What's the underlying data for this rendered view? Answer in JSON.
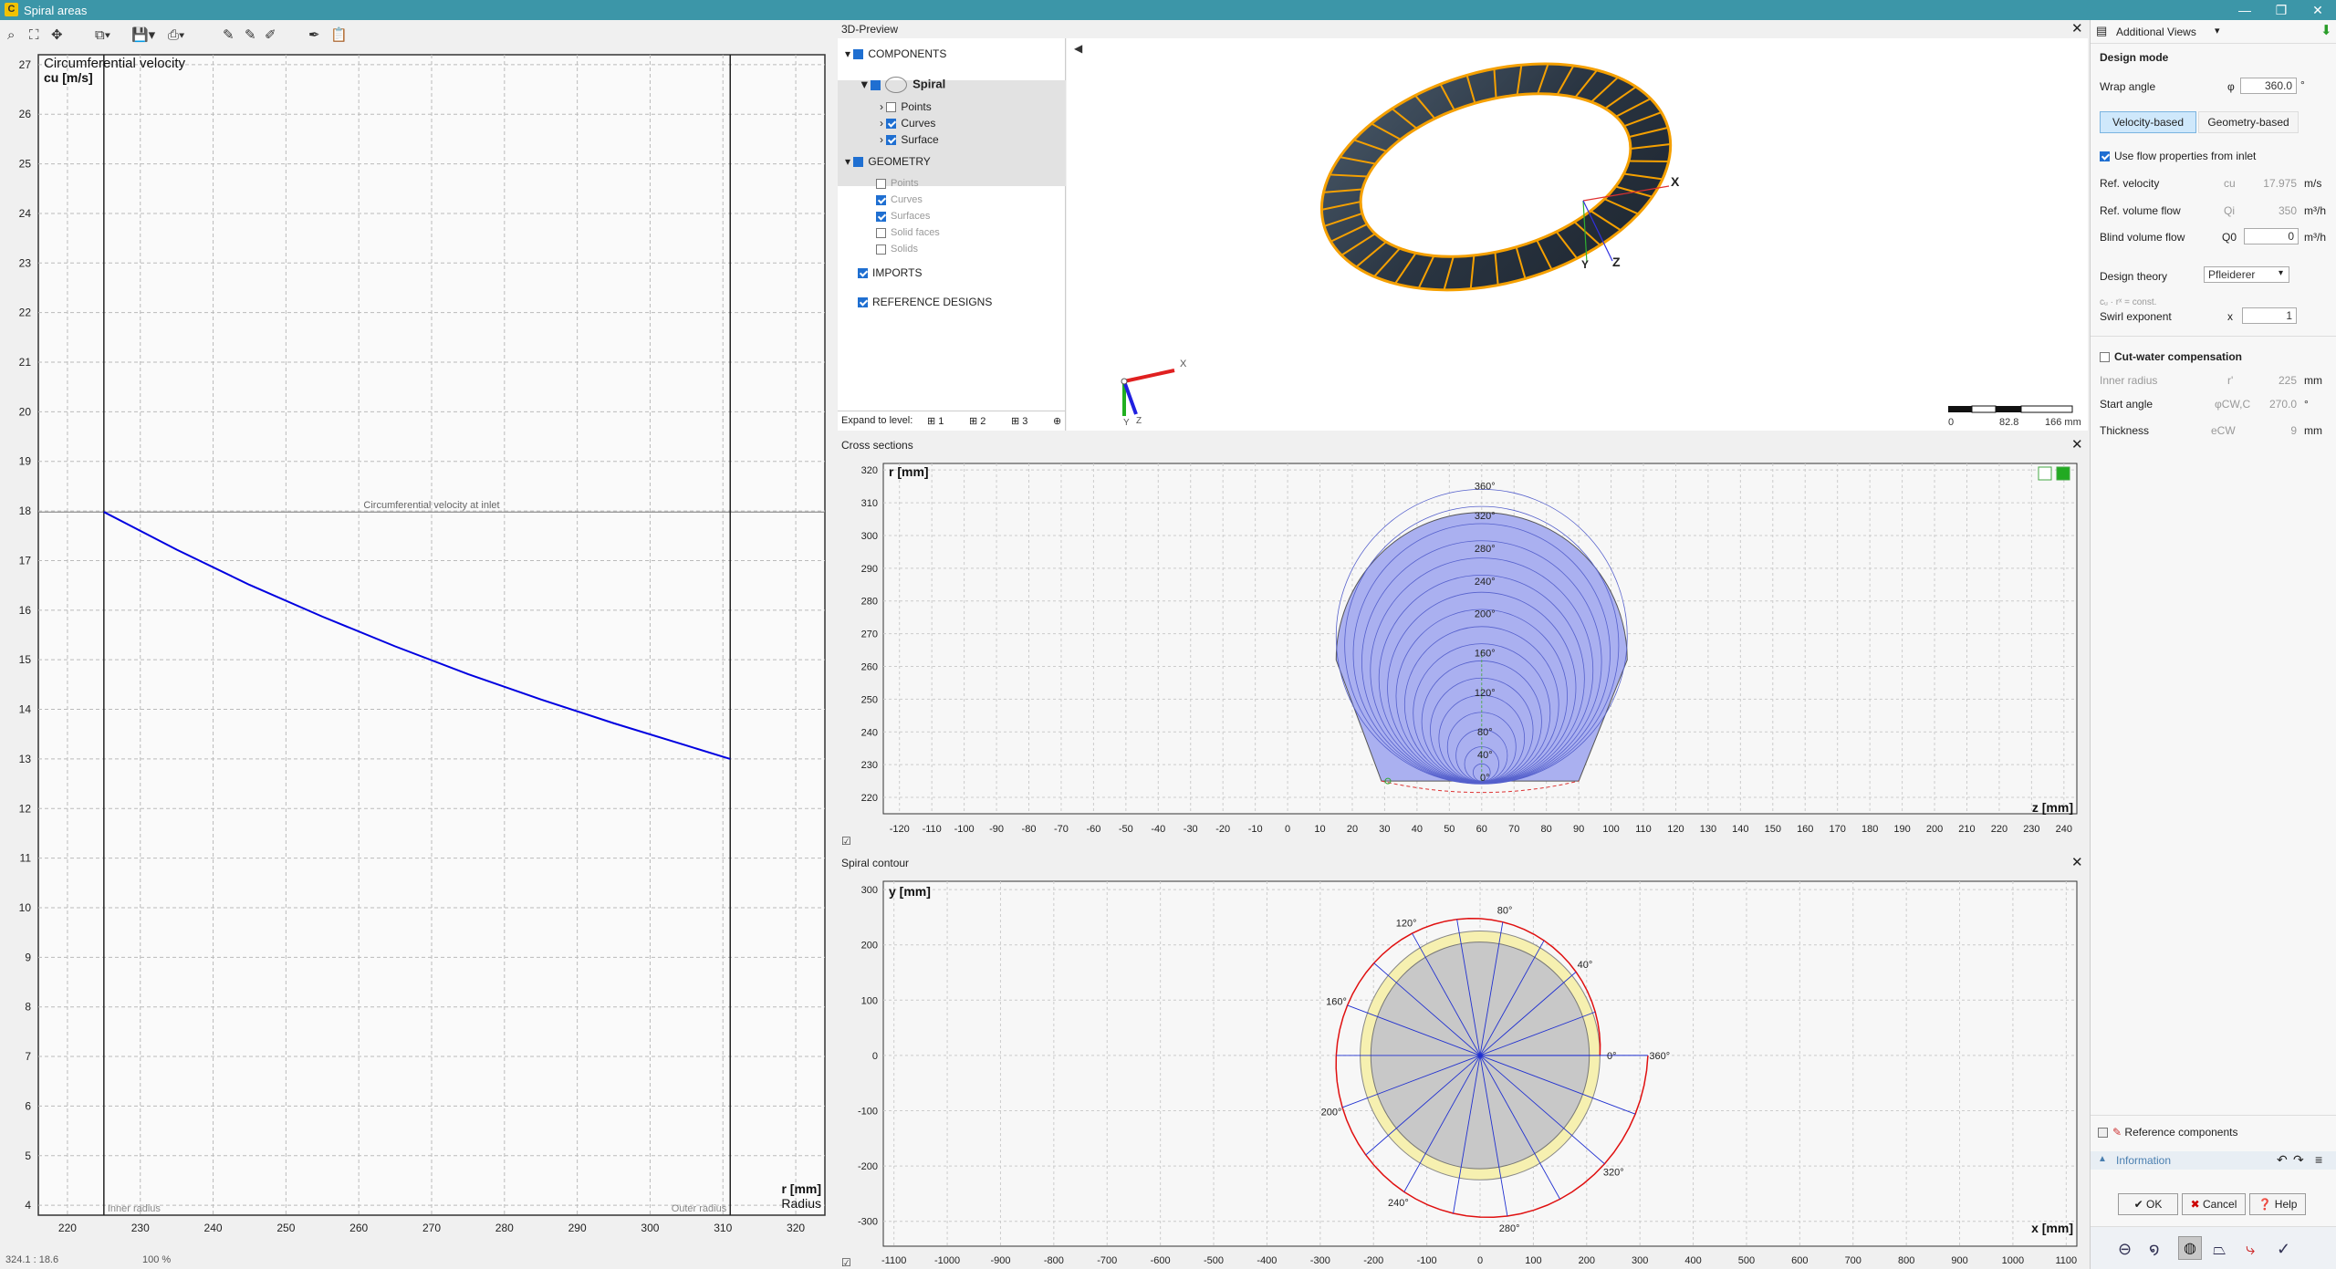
{
  "window": {
    "title": "Spiral areas",
    "app_icon": "C",
    "buttons": [
      "—",
      "❐",
      "✕"
    ]
  },
  "left_chart": {
    "title": "Circumferential velocity",
    "ylabel": "cu [m/s]",
    "xlabel": "r [mm]",
    "xlabel2": "Radius",
    "inlet_label": "Circumferential velocity at inlet",
    "inner_label": "Inner radius",
    "outer_label": "Outer radius",
    "status": "324.1 : 18.6",
    "zoom": "100 %"
  },
  "preview": {
    "title": "3D-Preview",
    "tree": {
      "components": "COMPONENTS",
      "spiral": "Spiral",
      "points": "Points",
      "curves": "Curves",
      "surface": "Surface",
      "geometry": "GEOMETRY",
      "g_points": "Points",
      "g_curves": "Curves",
      "g_surfaces": "Surfaces",
      "g_solid_faces": "Solid faces",
      "g_solids": "Solids",
      "imports": "IMPORTS",
      "reference": "REFERENCE DESIGNS"
    },
    "expand_label": "Expand to level:",
    "levels": [
      "1",
      "2",
      "3"
    ],
    "axis_x": "X",
    "axis_y": "Y",
    "axis_z": "Z",
    "scale": [
      "0",
      "82.8",
      "166 mm"
    ]
  },
  "cross_sections": {
    "title": "Cross sections",
    "ylabel": "r [mm]",
    "xlabel": "z [mm]"
  },
  "spiral_contour": {
    "title": "Spiral contour",
    "ylabel": "y [mm]",
    "xlabel": "x [mm]"
  },
  "right_panel": {
    "view_select": "Additional Views",
    "design_mode": "Design mode",
    "wrap_angle_label": "Wrap angle",
    "wrap_angle_sym": "φ",
    "wrap_angle_value": "360.0",
    "wrap_angle_unit": "°",
    "tab_velocity": "Velocity-based",
    "tab_geometry": "Geometry-based",
    "use_flow": "Use flow properties from inlet",
    "ref_velocity_label": "Ref. velocity",
    "ref_velocity_sym": "cu",
    "ref_velocity_value": "17.975",
    "ref_velocity_unit": "m/s",
    "ref_flow_label": "Ref. volume flow",
    "ref_flow_sym": "Qi",
    "ref_flow_value": "350",
    "ref_flow_unit": "m³/h",
    "blind_flow_label": "Blind volume flow",
    "blind_flow_sym": "Q0",
    "blind_flow_value": "0",
    "blind_flow_unit": "m³/h",
    "design_theory_label": "Design theory",
    "design_theory_value": "Pfleiderer",
    "formula": "cᵤ · rˣ = const.",
    "swirl_label": "Swirl exponent",
    "swirl_sym": "x",
    "swirl_value": "1",
    "cutwater_label": "Cut-water compensation",
    "inner_radius_label": "Inner radius",
    "inner_radius_sym": "r'",
    "inner_radius_value": "225",
    "inner_radius_unit": "mm",
    "start_angle_label": "Start angle",
    "start_angle_sym": "φCW,C",
    "start_angle_value": "270.0",
    "start_angle_unit": "°",
    "thickness_label": "Thickness",
    "thickness_sym": "eCW",
    "thickness_value": "9",
    "thickness_unit": "mm",
    "reference_components": "Reference components",
    "information": "Information",
    "ok": "OK",
    "cancel": "Cancel",
    "help": "Help"
  },
  "colors": {
    "titlebar": "#3c96a8",
    "curve": "#0000e0",
    "checkbox": "#1f6fd1"
  },
  "chart_data": [
    {
      "type": "line",
      "title": "Circumferential velocity",
      "xlabel": "r [mm]",
      "ylabel": "cu [m/s]",
      "xlim": [
        216,
        324
      ],
      "ylim": [
        3.8,
        27.2
      ],
      "xticks": [
        220,
        230,
        240,
        250,
        260,
        270,
        280,
        290,
        300,
        310,
        320
      ],
      "yticks": [
        4,
        5,
        6,
        7,
        8,
        9,
        10,
        11,
        12,
        13,
        14,
        15,
        16,
        17,
        18,
        19,
        20,
        21,
        22,
        23,
        24,
        25,
        26,
        27
      ],
      "series": [
        {
          "name": "",
          "x": [
            225,
            235,
            245,
            255,
            265,
            275,
            285,
            295,
            305,
            311
          ],
          "y": [
            17.98,
            17.22,
            16.51,
            15.87,
            15.27,
            14.71,
            14.2,
            13.72,
            13.27,
            13.0
          ]
        }
      ],
      "inner_radius": 225,
      "outer_radius": 311,
      "inlet_velocity": 17.98,
      "grid": true
    },
    {
      "type": "scatter",
      "title": "Cross sections",
      "xlabel": "z [mm]",
      "ylabel": "r [mm]",
      "xlim": [
        -125,
        244
      ],
      "ylim": [
        215,
        322
      ],
      "xticks": [
        -120,
        -110,
        -100,
        -90,
        -80,
        -70,
        -60,
        -50,
        -40,
        -30,
        -20,
        -10,
        0,
        10,
        20,
        30,
        40,
        50,
        60,
        70,
        80,
        90,
        100,
        110,
        120,
        130,
        140,
        150,
        160,
        170,
        180,
        190,
        200,
        210,
        220,
        230,
        240
      ],
      "yticks": [
        220,
        230,
        240,
        250,
        260,
        270,
        280,
        290,
        300,
        310,
        320
      ],
      "angle_labels": [
        {
          "label": "360°",
          "z": 61,
          "r": 314
        },
        {
          "label": "320°",
          "z": 61,
          "r": 305
        },
        {
          "label": "280°",
          "z": 61,
          "r": 295
        },
        {
          "label": "240°",
          "z": 61,
          "r": 285
        },
        {
          "label": "200°",
          "z": 61,
          "r": 275
        },
        {
          "label": "160°",
          "z": 61,
          "r": 263
        },
        {
          "label": "120°",
          "z": 61,
          "r": 251
        },
        {
          "label": "80°",
          "z": 61,
          "r": 239
        },
        {
          "label": "40°",
          "z": 61,
          "r": 232
        },
        {
          "label": "0°",
          "z": 61,
          "r": 225
        }
      ],
      "grid": true
    },
    {
      "type": "scatter",
      "title": "Spiral contour",
      "xlabel": "x [mm]",
      "ylabel": "y [mm]",
      "xlim": [
        -1120,
        1120
      ],
      "ylim": [
        -345,
        315
      ],
      "xticks": [
        -1100,
        -1000,
        -900,
        -800,
        -700,
        -600,
        -500,
        -400,
        -300,
        -200,
        -100,
        0,
        100,
        200,
        300,
        400,
        500,
        600,
        700,
        800,
        900,
        1000,
        1100
      ],
      "yticks": [
        -300,
        -200,
        -100,
        0,
        100,
        200,
        300
      ],
      "angle_labels": [
        "0°",
        "40°",
        "80°",
        "120°",
        "160°",
        "200°",
        "240°",
        "280°",
        "320°",
        "360°"
      ],
      "grid": true
    }
  ]
}
